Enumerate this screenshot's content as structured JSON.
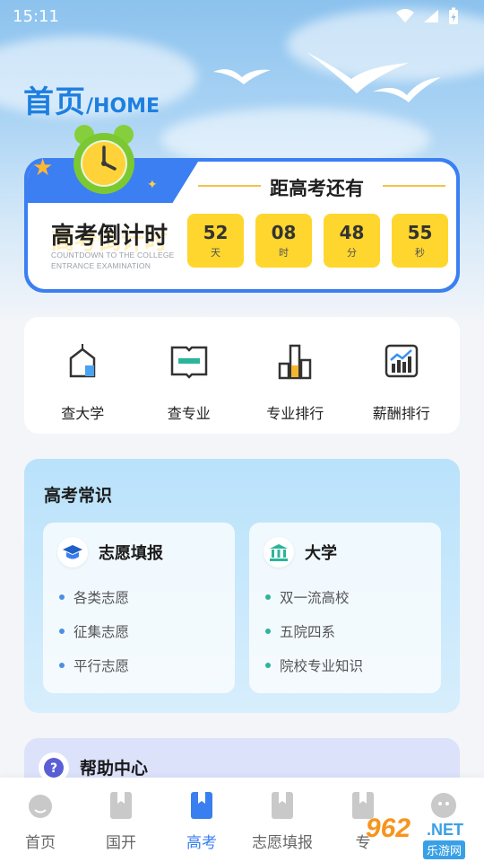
{
  "status": {
    "time": "15:11"
  },
  "header": {
    "title_zh": "首页",
    "title_en": "/HOME"
  },
  "countdown": {
    "subtitle": "距高考还有",
    "title": "高考倒计时",
    "en_line1": "COUNTDOWN TO THE COLLEGE",
    "en_line2": "ENTRANCE EXAMINATION",
    "units": [
      {
        "value": "52",
        "label": "天"
      },
      {
        "value": "08",
        "label": "时"
      },
      {
        "value": "48",
        "label": "分"
      },
      {
        "value": "55",
        "label": "秒"
      }
    ]
  },
  "tools": [
    {
      "label": "查大学",
      "icon": "university-icon"
    },
    {
      "label": "查专业",
      "icon": "book-icon"
    },
    {
      "label": "专业排行",
      "icon": "bar-chart-icon"
    },
    {
      "label": "薪酬排行",
      "icon": "trend-chart-icon"
    }
  ],
  "knowledge": {
    "title": "高考常识",
    "cards": [
      {
        "title": "志愿填报",
        "icon": "graduation-cap-icon",
        "dot_color": "#4a90e2",
        "items": [
          "各类志愿",
          "征集志愿",
          "平行志愿"
        ]
      },
      {
        "title": "大学",
        "icon": "institution-icon",
        "dot_color": "#2bb59a",
        "items": [
          "双一流高校",
          "五院四系",
          "院校专业知识"
        ]
      }
    ]
  },
  "help": {
    "title": "帮助中心"
  },
  "nav": {
    "items": [
      {
        "label": "首页",
        "icon": "home-icon"
      },
      {
        "label": "国开",
        "icon": "bookmark-icon"
      },
      {
        "label": "高考",
        "icon": "bookmark-icon"
      },
      {
        "label": "志愿填报",
        "icon": "bookmark-icon"
      },
      {
        "label": "专",
        "icon": "bookmark-icon"
      },
      {
        "label": "",
        "icon": "profile-icon"
      }
    ],
    "active_index": 2,
    "active_color": "#3a7ff0"
  },
  "watermark": {
    "num": "962",
    "net": ".NET",
    "sub": "乐游网"
  },
  "colors": {
    "accent": "#3b7ff2",
    "countdown_box": "#ffd62e"
  }
}
